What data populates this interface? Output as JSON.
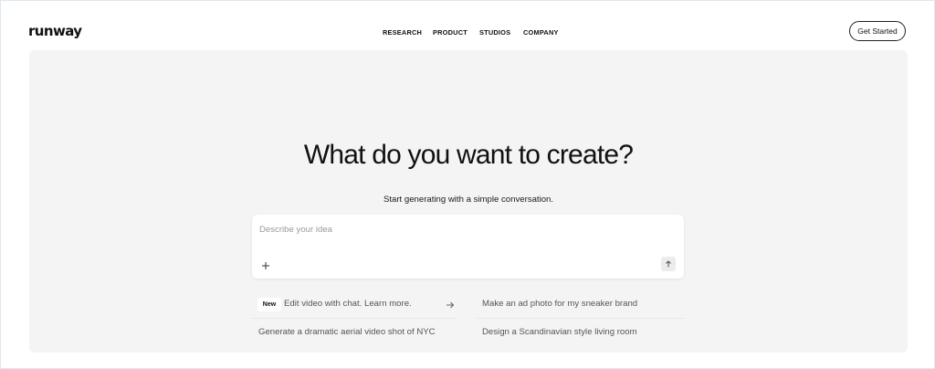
{
  "brand": {
    "logo_text": "runway"
  },
  "nav": {
    "items": [
      {
        "label": "RESEARCH"
      },
      {
        "label": "PRODUCT"
      },
      {
        "label": "STUDIOS"
      },
      {
        "label": "COMPANY"
      }
    ],
    "cta_label": "Get Started"
  },
  "hero": {
    "title": "What do you want to create?",
    "subtitle": "Start generating with a simple conversation."
  },
  "prompt": {
    "placeholder": "Describe your idea",
    "value": ""
  },
  "suggestions": {
    "new_badge": "New",
    "items": [
      {
        "text": "Edit video with chat. Learn more."
      },
      {
        "text": "Make an ad photo for my sneaker brand"
      },
      {
        "text": "Generate a dramatic aerial video shot of NYC"
      },
      {
        "text": "Design a Scandinavian style living room"
      }
    ]
  },
  "icons": {
    "add": "plus-icon",
    "send": "arrow-up-icon",
    "link": "arrow-right-icon"
  },
  "colors": {
    "hero_background": "#f4f4f4",
    "text_primary": "#111111",
    "text_muted": "#555555",
    "placeholder": "#9a9a9a"
  }
}
